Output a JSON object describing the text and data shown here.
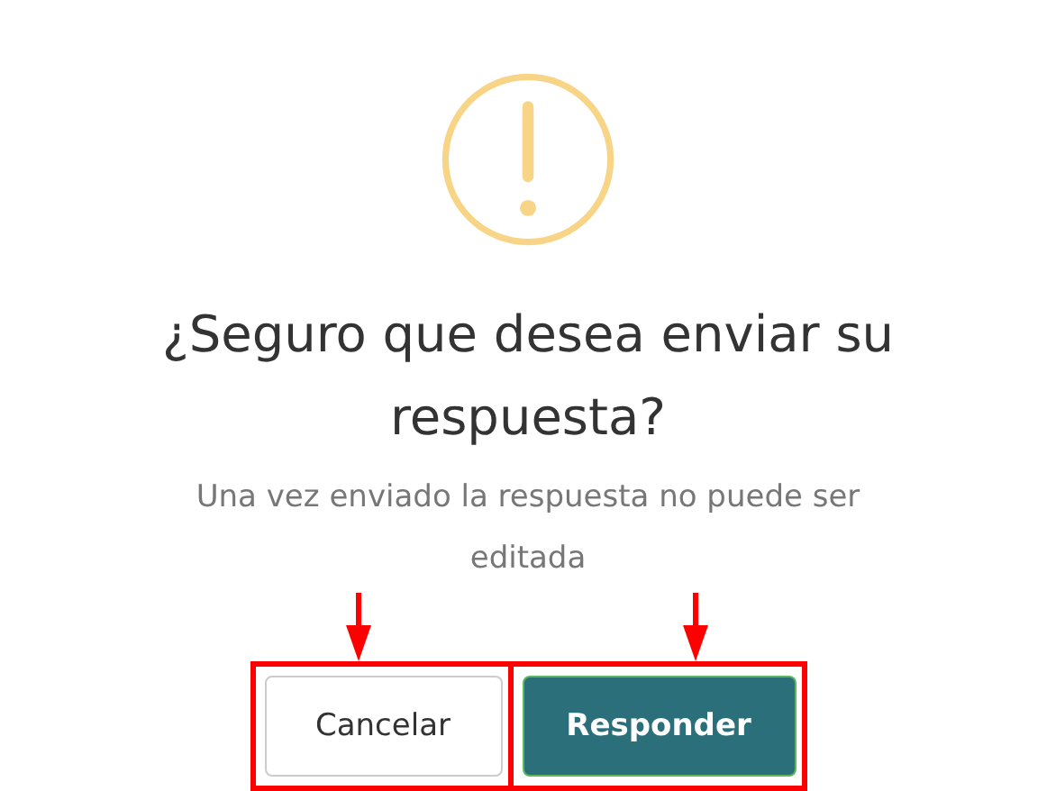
{
  "dialog": {
    "title": "¿Seguro que desea enviar su respuesta?",
    "text": "Una vez enviado la respuesta no puede ser editada",
    "buttons": [
      {
        "label": "Cancelar",
        "kind": "cancel"
      },
      {
        "label": "Responder",
        "kind": "confirm"
      }
    ]
  }
}
